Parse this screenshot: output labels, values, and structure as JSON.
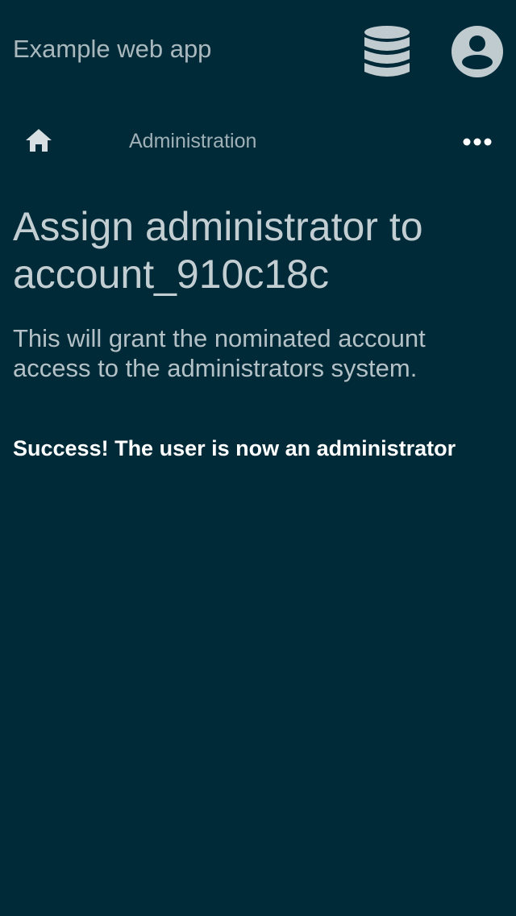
{
  "header": {
    "app_title": "Example web app",
    "database_icon": "database-icon",
    "account_icon": "account-circle-icon"
  },
  "nav": {
    "home_icon": "home-icon",
    "breadcrumb": "Administration",
    "more_icon": "more-horizontal-icon"
  },
  "main": {
    "title": "Assign administrator to account_910c18c",
    "description": "This will grant the nominated account access to the administrators system.",
    "success_message": "Success! The user is now an administrator"
  },
  "colors": {
    "background": "#002a38",
    "icon": "#c0cbcf",
    "text_muted": "#a9b8bd",
    "text_strong": "#ffffff"
  }
}
